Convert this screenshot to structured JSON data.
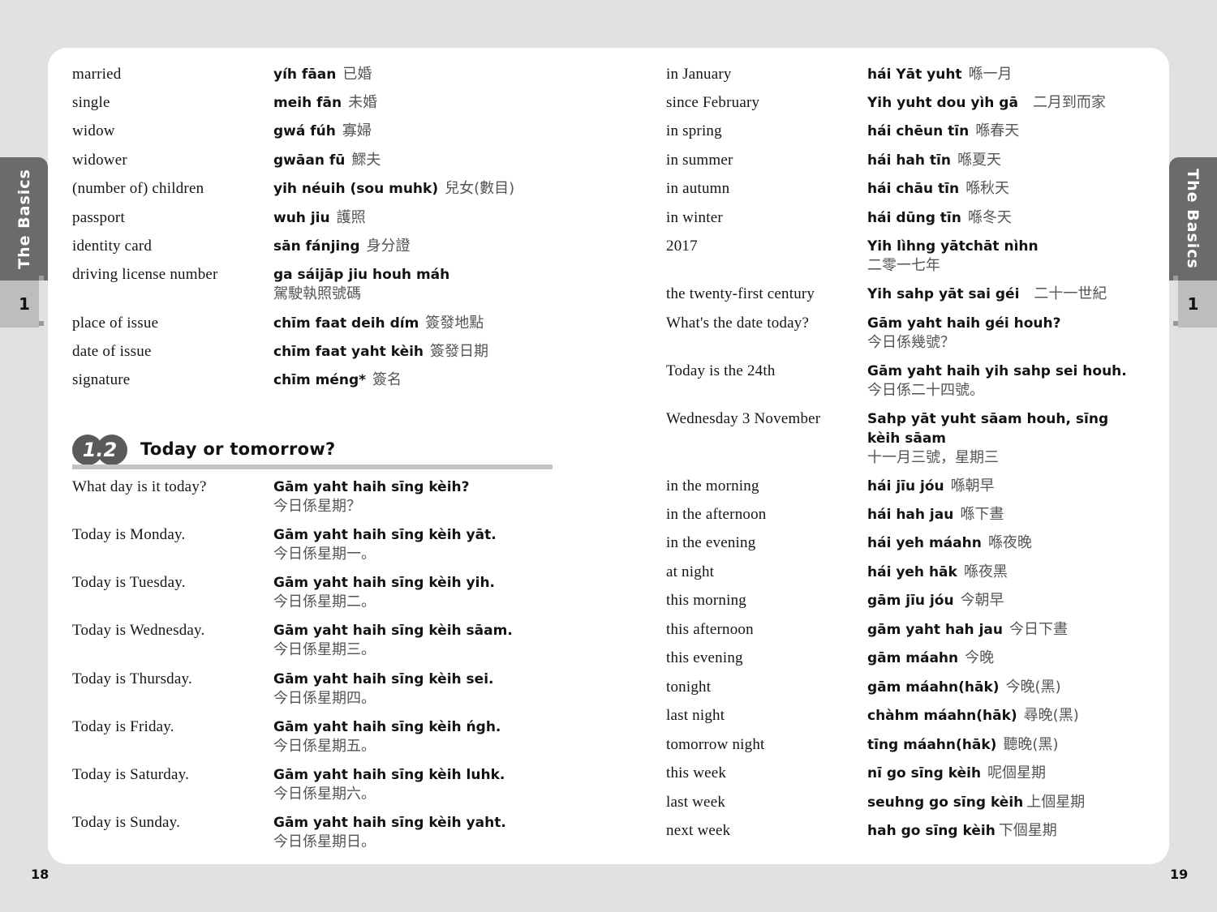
{
  "side_tab": {
    "label": "The Basics",
    "chapter": "1"
  },
  "page_numbers": {
    "left": "18",
    "right": "19"
  },
  "left_page": {
    "vocab": [
      {
        "en": "married",
        "yue": "yíh fāan",
        "zh": "已婚"
      },
      {
        "en": "single",
        "yue": "meih fān",
        "zh": "未婚"
      },
      {
        "en": "widow",
        "yue": "gwá fúh",
        "zh": "寡婦"
      },
      {
        "en": "widower",
        "yue": "gwāan fū",
        "zh": "鰥夫"
      },
      {
        "en": "(number of) children",
        "yue": "yih néuih (sou muhk)",
        "zh": "兒女(數目)"
      },
      {
        "en": "passport",
        "yue": "wuh jiu",
        "zh": "護照"
      },
      {
        "en": "identity card",
        "yue": "sān fánjing",
        "zh": "身分證"
      },
      {
        "en": "driving license number",
        "yue": "ga sáijāp jiu houh máh",
        "zh": "駕駛執照號碼"
      },
      {
        "en": "place of issue",
        "yue": "chīm faat deih dím",
        "zh": "簽發地點"
      },
      {
        "en": "date of issue",
        "yue": "chīm faat yaht kèih",
        "zh": "簽發日期"
      },
      {
        "en": "signature",
        "yue": "chīm méng*",
        "zh": "簽名"
      }
    ],
    "section": {
      "number": "1.2",
      "title": "Today or tomorrow?"
    },
    "phrases": [
      {
        "en": "What day is it today?",
        "yue": "Gām yaht haih sīng kèih?",
        "zh": "今日係星期？"
      },
      {
        "en": "Today is Monday.",
        "yue": "Gām yaht haih sīng kèih yāt.",
        "zh": "今日係星期一。"
      },
      {
        "en": "Today is Tuesday.",
        "yue": "Gām yaht haih sīng kèih yih.",
        "zh": "今日係星期二。"
      },
      {
        "en": "Today is Wednesday.",
        "yue": "Gām yaht haih sīng kèih sāam.",
        "zh": "今日係星期三。"
      },
      {
        "en": "Today is Thursday.",
        "yue": "Gām yaht haih sīng kèih sei.",
        "zh": "今日係星期四。"
      },
      {
        "en": "Today is Friday.",
        "yue": "Gām yaht haih sīng kèih ńgh.",
        "zh": "今日係星期五。"
      },
      {
        "en": "Today is Saturday.",
        "yue": "Gām yaht haih sīng kèih luhk.",
        "zh": "今日係星期六。"
      },
      {
        "en": "Today is Sunday.",
        "yue": "Gām yaht haih sīng kèih yaht.",
        "zh": "今日係星期日。"
      }
    ]
  },
  "right_page": {
    "entries": [
      {
        "en": "in January",
        "yue": "hái Yāt yuht",
        "zh": "喺一月"
      },
      {
        "en": "since February",
        "yue": "Yih yuht dou yìh gā",
        "zh": "二月到而家"
      },
      {
        "en": "in spring",
        "yue": "hái chēun tīn",
        "zh": "喺春天"
      },
      {
        "en": "in summer",
        "yue": "hái hah tīn",
        "zh": "喺夏天"
      },
      {
        "en": "in autumn",
        "yue": "hái chāu tīn",
        "zh": "喺秋天"
      },
      {
        "en": "in winter",
        "yue": "hái dūng tīn",
        "zh": "喺冬天"
      },
      {
        "en": "2017",
        "yue": "Yih lìhng yātchāt nìhn",
        "zh": "二零一七年"
      },
      {
        "en": "the twenty-first century",
        "yue": "Yih sahp yāt sai géi",
        "zh": "二十一世紀"
      },
      {
        "en": "What's the date today?",
        "yue": "Gām yaht haih géi houh?",
        "zh": "今日係幾號？"
      },
      {
        "en": "Today is the 24th",
        "yue": "Gām yaht haih yih sahp sei houh.",
        "zh": "今日係二十四號。"
      },
      {
        "en": "Wednesday 3 November",
        "yue": "Sahp yāt yuht sāam houh, sīng kèih sāam",
        "zh": "十一月三號，星期三"
      },
      {
        "en": "in the morning",
        "yue": "hái jīu jóu",
        "zh": "喺朝早"
      },
      {
        "en": "in the afternoon",
        "yue": "hái hah jau",
        "zh": "喺下晝"
      },
      {
        "en": "in the evening",
        "yue": "hái yeh máahn",
        "zh": "喺夜晚"
      },
      {
        "en": "at night",
        "yue": "hái yeh hāk",
        "zh": "喺夜黑"
      },
      {
        "en": "this morning",
        "yue": "gām jīu jóu",
        "zh": "今朝早"
      },
      {
        "en": "this afternoon",
        "yue": "gām yaht hah jau",
        "zh": "今日下晝"
      },
      {
        "en": "this evening",
        "yue": "gām máahn",
        "zh": "今晚"
      },
      {
        "en": "tonight",
        "yue": "gām máahn(hāk)",
        "zh": "今晚(黑)"
      },
      {
        "en": "last night",
        "yue": "chàhm máahn(hāk)",
        "zh": "尋晚(黑)"
      },
      {
        "en": "tomorrow night",
        "yue": "tīng máahn(hāk)",
        "zh": "聽晚(黑)"
      },
      {
        "en": "this week",
        "yue": "nī go sīng kèih",
        "zh": "呢個星期"
      },
      {
        "en": "last week",
        "yue": "seuhng go sīng kèih",
        "zh": "上個星期"
      },
      {
        "en": "next week",
        "yue": "hah go sīng kèih",
        "zh": "下個星期"
      }
    ]
  }
}
